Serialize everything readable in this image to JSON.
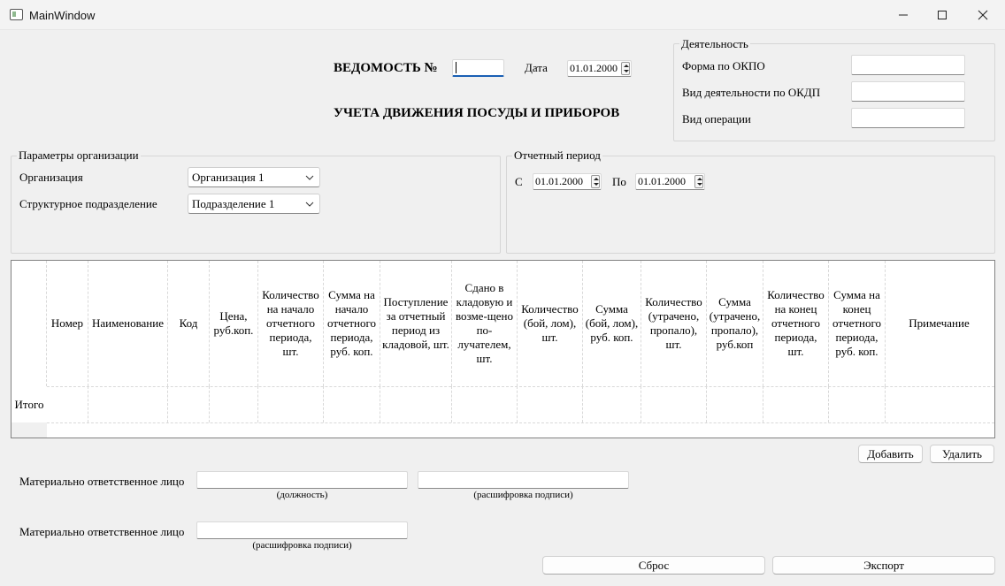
{
  "window": {
    "title": "MainWindow"
  },
  "header": {
    "statement_label": "ВЕДОМОСТЬ №",
    "statement_number": "",
    "date_label": "Дата",
    "date_value": "01.01.2000",
    "subtitle": "УЧЕТА ДВИЖЕНИЯ ПОСУДЫ И ПРИБОРОВ"
  },
  "activity": {
    "title": "Деятельность",
    "okpo_label": "Форма по ОКПО",
    "okdp_label": "Вид деятельности по ОКДП",
    "operation_label": "Вид операции"
  },
  "org_params": {
    "title": "Параметры организации",
    "org_label": "Организация",
    "org_value": "Организация 1",
    "unit_label": "Структурное подразделение",
    "unit_value": "Подразделение 1"
  },
  "period": {
    "title": "Отчетный период",
    "from_label": "С",
    "from_value": "01.01.2000",
    "to_label": "По",
    "to_value": "01.01.2000"
  },
  "table": {
    "columns": [
      "Номер",
      "Наименование",
      "Код",
      "Цена, руб.коп.",
      "Количество на начало отчетного периода, шт.",
      "Сумма на начало отчетного периода, руб. коп.",
      "Поступление за отчетный период из кладовой, шт.",
      "Сдано в кладовую и возме-щено по-лучателем, шт.",
      "Количество (бой, лом), шт.",
      "Сумма (бой, лом), руб. коп.",
      "Количество (утрачено, пропало), шт.",
      "Сумма (утрачено, пропало), руб.коп",
      "Количество на конец отчетного периода, шт.",
      "Сумма на конец отчетного периода, руб. коп.",
      "Примечание"
    ],
    "total_row_label": "Итого"
  },
  "actions": {
    "add": "Добавить",
    "delete": "Удалить",
    "reset": "Сброс",
    "export": "Экспорт"
  },
  "signatures": {
    "person_label_1": "Материально ответственное лицо",
    "position_caption": "(должность)",
    "decode_caption_1": "(расшифровка подписи)",
    "person_label_2": "Материально ответственное лицо",
    "decode_caption_2": "(расшифровка подписи)"
  }
}
